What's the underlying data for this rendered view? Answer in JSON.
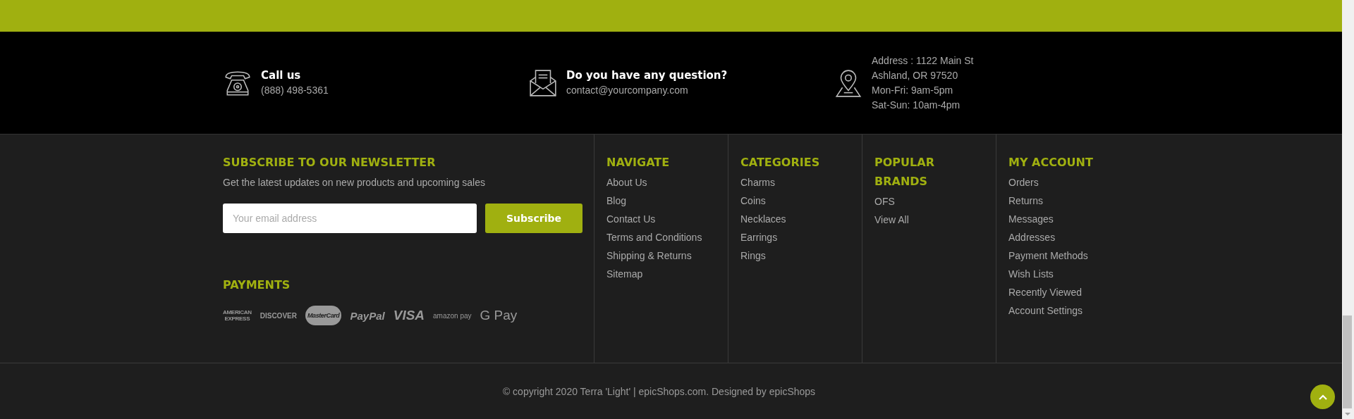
{
  "contacts": [
    {
      "kind": "phone",
      "title": "Call us",
      "lines": [
        "(888) 498-5361"
      ]
    },
    {
      "kind": "mail",
      "title": "Do you have any question?",
      "lines": [
        "contact@yourcompany.com"
      ]
    },
    {
      "kind": "pin",
      "lines": [
        "Address : 1122 Main St",
        "Ashland, OR 97520",
        "Mon-Fri: 9am-5pm",
        "Sat-Sun: 10am-4pm"
      ]
    }
  ],
  "newsletter": {
    "title": "SUBSCRIBE TO OUR NEWSLETTER",
    "text": "Get the latest updates on new products and upcoming sales",
    "placeholder": "Your email address",
    "button": "Subscribe"
  },
  "payments": {
    "title": "PAYMENTS",
    "logos": [
      {
        "kind": "amex",
        "lines": [
          "AMERICAN",
          "EXPRESS"
        ]
      },
      {
        "kind": "discover",
        "lines": [
          "DISCOVER"
        ]
      },
      {
        "kind": "mastercard",
        "lines": [
          "MasterCard"
        ]
      },
      {
        "kind": "paypal",
        "lines": [
          "PayPal"
        ]
      },
      {
        "kind": "visa",
        "lines": [
          "VISA"
        ]
      },
      {
        "kind": "amazon",
        "lines": [
          "amazon pay"
        ]
      },
      {
        "kind": "gpay",
        "lines": [
          "G Pay"
        ]
      }
    ]
  },
  "columns": [
    {
      "title": "NAVIGATE",
      "links": [
        "About Us",
        "Blog",
        "Contact Us",
        "Terms and Conditions",
        "Shipping & Returns",
        "Sitemap"
      ]
    },
    {
      "title": "CATEGORIES",
      "links": [
        "Charms",
        "Coins",
        "Necklaces",
        "Earrings",
        "Rings"
      ]
    },
    {
      "title": "POPULAR BRANDS",
      "links": [
        "OFS",
        "View All"
      ]
    },
    {
      "title": "MY ACCOUNT",
      "links": [
        "Orders",
        "Returns",
        "Messages",
        "Addresses",
        "Payment Methods",
        "Wish Lists",
        "Recently Viewed",
        "Account Settings"
      ]
    }
  ],
  "copyright": "© copyright 2020 Terra 'Light' | epicShops.com. Designed by epicShops"
}
